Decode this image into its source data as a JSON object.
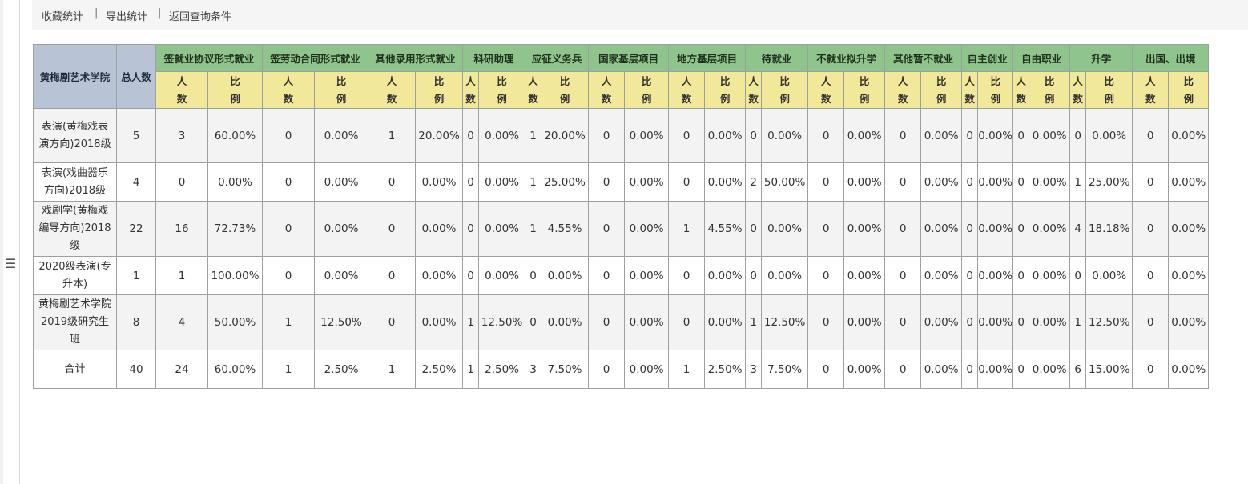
{
  "toolbar": {
    "links": [
      "收藏统计",
      "导出统计",
      "返回查询条件"
    ],
    "separator": "|"
  },
  "table": {
    "corner_label": "黄梅剧艺术学院",
    "total_label": "总人数",
    "groups": [
      "签就业协议形式就业",
      "签劳动合同形式就业",
      "其他录用形式就业",
      "科研助理",
      "应征义务兵",
      "国家基层项目",
      "地方基层项目",
      "待就业",
      "不就业拟升学",
      "其他暂不就业",
      "自主创业",
      "自由职业",
      "升学",
      "出国、出境"
    ],
    "sub_count": "人数",
    "sub_ratio": "比例",
    "rows": [
      {
        "name": "表演(黄梅戏表演方向)2018级",
        "total": "5",
        "cells": [
          "3",
          "60.00%",
          "0",
          "0.00%",
          "1",
          "20.00%",
          "0",
          "0.00%",
          "1",
          "20.00%",
          "0",
          "0.00%",
          "0",
          "0.00%",
          "0",
          "0.00%",
          "0",
          "0.00%",
          "0",
          "0.00%",
          "0",
          "0.00%",
          "0",
          "0.00%",
          "0",
          "0.00%",
          "0",
          "0.00%"
        ]
      },
      {
        "name": "表演(戏曲器乐方向)2018级",
        "total": "4",
        "cells": [
          "0",
          "0.00%",
          "0",
          "0.00%",
          "0",
          "0.00%",
          "0",
          "0.00%",
          "1",
          "25.00%",
          "0",
          "0.00%",
          "0",
          "0.00%",
          "2",
          "50.00%",
          "0",
          "0.00%",
          "0",
          "0.00%",
          "0",
          "0.00%",
          "0",
          "0.00%",
          "1",
          "25.00%",
          "0",
          "0.00%"
        ]
      },
      {
        "name": "戏剧学(黄梅戏编导方向)2018级",
        "total": "22",
        "cells": [
          "16",
          "72.73%",
          "0",
          "0.00%",
          "0",
          "0.00%",
          "0",
          "0.00%",
          "1",
          "4.55%",
          "0",
          "0.00%",
          "1",
          "4.55%",
          "0",
          "0.00%",
          "0",
          "0.00%",
          "0",
          "0.00%",
          "0",
          "0.00%",
          "0",
          "0.00%",
          "4",
          "18.18%",
          "0",
          "0.00%"
        ]
      },
      {
        "name": "2020级表演(专升本)",
        "total": "1",
        "cells": [
          "1",
          "100.00%",
          "0",
          "0.00%",
          "0",
          "0.00%",
          "0",
          "0.00%",
          "0",
          "0.00%",
          "0",
          "0.00%",
          "0",
          "0.00%",
          "0",
          "0.00%",
          "0",
          "0.00%",
          "0",
          "0.00%",
          "0",
          "0.00%",
          "0",
          "0.00%",
          "0",
          "0.00%",
          "0",
          "0.00%"
        ]
      },
      {
        "name": "黄梅剧艺术学院2019级研究生班",
        "total": "8",
        "cells": [
          "4",
          "50.00%",
          "1",
          "12.50%",
          "0",
          "0.00%",
          "1",
          "12.50%",
          "0",
          "0.00%",
          "0",
          "0.00%",
          "0",
          "0.00%",
          "1",
          "12.50%",
          "0",
          "0.00%",
          "0",
          "0.00%",
          "0",
          "0.00%",
          "0",
          "0.00%",
          "1",
          "12.50%",
          "0",
          "0.00%"
        ]
      },
      {
        "name": "合计",
        "total": "40",
        "cells": [
          "24",
          "60.00%",
          "1",
          "2.50%",
          "1",
          "2.50%",
          "1",
          "2.50%",
          "3",
          "7.50%",
          "0",
          "0.00%",
          "1",
          "2.50%",
          "3",
          "7.50%",
          "0",
          "0.00%",
          "0",
          "0.00%",
          "0",
          "0.00%",
          "0",
          "0.00%",
          "6",
          "15.00%",
          "0",
          "0.00%"
        ]
      }
    ]
  },
  "colors": {
    "header_green": "#8fc48c",
    "header_blue": "#b9c3d6",
    "header_yellow": "#f2e89a"
  }
}
